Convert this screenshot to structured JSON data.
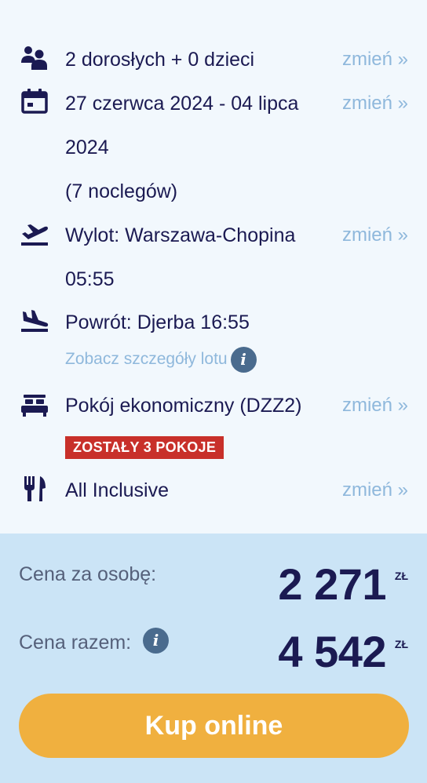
{
  "details": {
    "travelers": {
      "text": "2 dorosłych + 0 dzieci",
      "change": "zmień »",
      "icon": "people-icon"
    },
    "dates": {
      "line1": "27 czerwca 2024 - 04 lipca",
      "line2": "2024",
      "line3": "(7 noclegów)",
      "change": "zmień »",
      "icon": "calendar-icon"
    },
    "departure": {
      "line1": "Wylot: Warszawa-Chopina",
      "line2": "05:55",
      "change": "zmień »",
      "icon": "plane-takeoff-icon"
    },
    "return": {
      "line1": "Powrót: Djerba 16:55",
      "details_link": "Zobacz szczegóły lotu",
      "icon": "plane-landing-icon"
    },
    "room": {
      "text": "Pokój ekonomiczny (DZZ2)",
      "change": "zmień »",
      "badge": "ZOSTAŁY 3 POKOJE",
      "icon": "bed-icon"
    },
    "board": {
      "text": "All Inclusive",
      "change": "zmień »",
      "icon": "cutlery-icon"
    }
  },
  "price": {
    "per_person_label": "Cena za osobę:",
    "per_person_value": "2 271",
    "total_label": "Cena razem:",
    "total_value": "4 542",
    "currency": "ZŁ",
    "info_glyph": "i"
  },
  "buy_button": "Kup online",
  "colors": {
    "navy": "#1b1a52",
    "link": "#8fb8dc",
    "badge": "#c8302a",
    "button": "#f0b03f",
    "price_bg": "#cbe4f6"
  }
}
